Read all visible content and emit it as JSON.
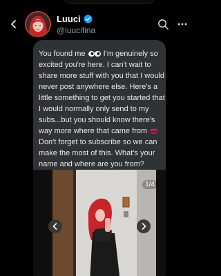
{
  "header": {
    "name": "Luuci",
    "handle": "@luucifina",
    "verified_color": "#1d9bf0"
  },
  "message": {
    "part1": "You found me ",
    "part2": " I'm genuinely so excited you're here. I can't wait to share more stuff with you that I would never post anywhere else. Here's a little something to get you started that I would normally only send to my subs...but you should know there's way more where that came from ",
    "part3": " Don't forget to subscribe so we can make the most of this. What's your name and where are you from?",
    "emoji1": "eyes",
    "emoji2": "kiss-mark"
  },
  "media": {
    "counter": "1/4"
  },
  "icons": {
    "back": "chevron-left-icon",
    "search": "search-icon",
    "more": "more-horizontal-icon",
    "prev": "chevron-left-icon",
    "next": "chevron-right-icon"
  }
}
